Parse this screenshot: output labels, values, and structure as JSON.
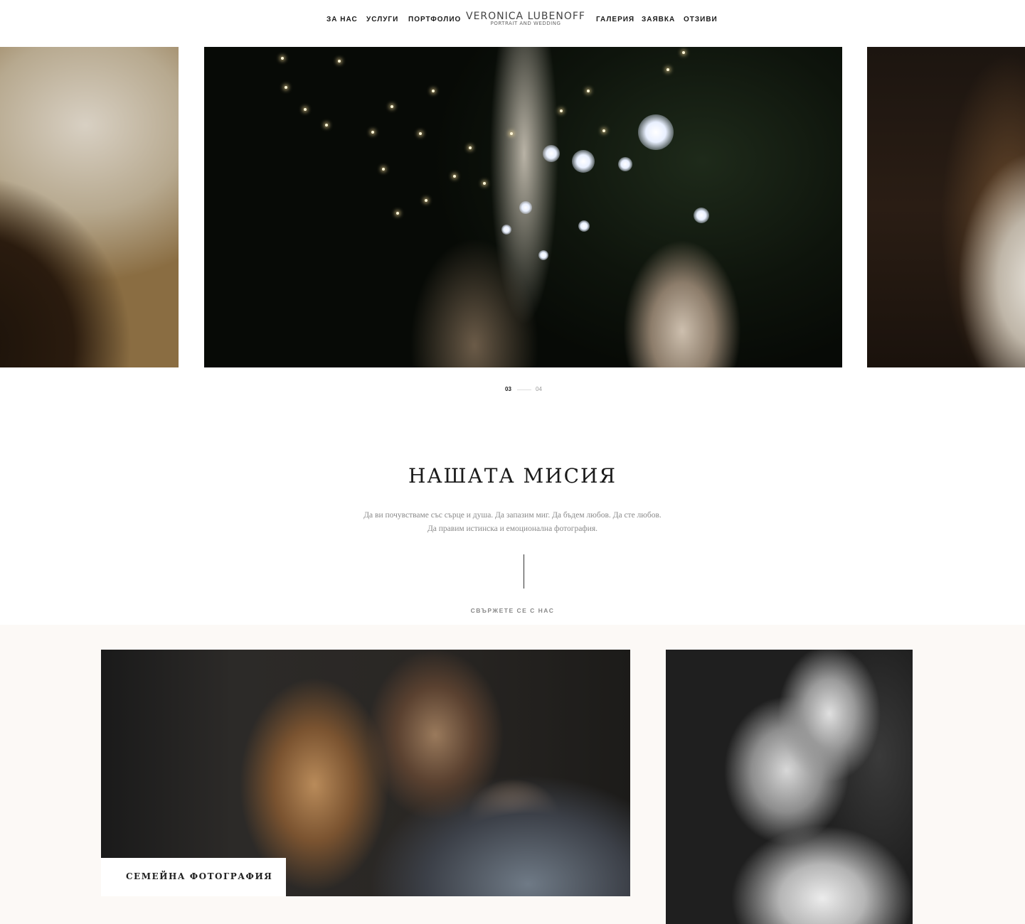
{
  "header": {
    "nav_left": [
      "ЗА НАС",
      "УСЛУГИ",
      "ПОРТФОЛИО"
    ],
    "nav_right": [
      "ГАЛЕРИЯ",
      "ЗАЯВКА",
      "ОТЗИВИ"
    ],
    "logo_name": "VERONICA LUBENOFF",
    "logo_tagline": "PORTRAIT AND WEDDING"
  },
  "slider": {
    "current": "03",
    "next": "04",
    "active_color": "#1a1a1a",
    "inactive_color": "#999999"
  },
  "mission": {
    "title": "НАШАТА МИСИЯ",
    "text_line1": "Да ви почувстваме със сърце и душа. Да запазим миг. Да бъдем любов. Да сте любов.",
    "text_line2": "Да правим истинска и емоционална фотография.",
    "contact_link": "СВЪРЖЕТЕ СЕ С НАС"
  },
  "gallery": {
    "family_label": "СЕМЕЙНА ФОТОГРАФИЯ",
    "background": "#fcf9f6"
  }
}
